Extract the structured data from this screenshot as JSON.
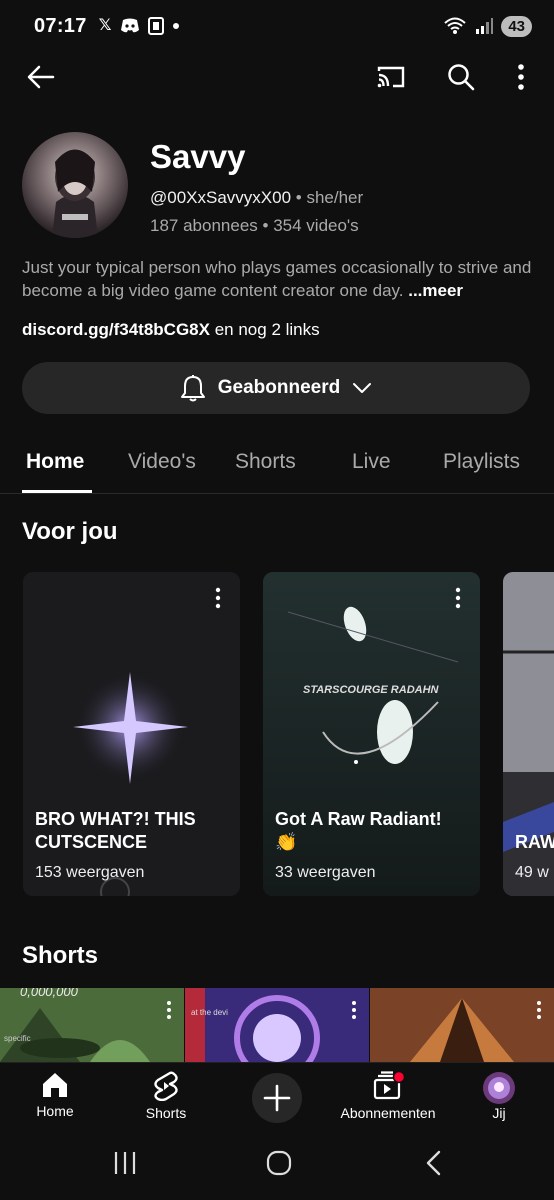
{
  "status_bar": {
    "time": "07:17",
    "notification_icons": [
      "x-logo-icon",
      "discord-icon",
      "app-icon",
      "dot-icon"
    ],
    "battery": "43"
  },
  "app_bar": {
    "icons": [
      "back-arrow-icon",
      "cast-icon",
      "search-icon",
      "more-vert-icon"
    ]
  },
  "channel": {
    "name": "Savvy",
    "handle": "@00XxSavvyxX00",
    "pronouns": "she/her",
    "subscribers": "187 abonnees",
    "videos": "354 video's",
    "separator": "•",
    "description": "Just your typical person who plays games occasionally to strive and become a big video game content creator one day.",
    "more_label": "...meer",
    "link": "discord.gg/f34t8bCG8X",
    "link_rest": "en nog 2 links"
  },
  "subscribe": {
    "label": "Geabonneerd"
  },
  "tabs": [
    {
      "label": "Home",
      "active": true
    },
    {
      "label": "Video's",
      "active": false
    },
    {
      "label": "Shorts",
      "active": false
    },
    {
      "label": "Live",
      "active": false
    },
    {
      "label": "Playlists",
      "active": false
    }
  ],
  "for_you": {
    "title": "Voor jou",
    "cards": [
      {
        "title": "BRO WHAT?! THIS CUTSCENCE",
        "views": "153 weergaven"
      },
      {
        "title": "Got A Raw Radiant! 👏",
        "views": "33 weergaven",
        "overlay": "STARSCOURGE RADAHN"
      },
      {
        "title": "RAW",
        "views": "49 w"
      }
    ]
  },
  "shorts": {
    "title": "Shorts",
    "thumb_text": [
      "0,000,000",
      "at the devi",
      "specific"
    ]
  },
  "bottom_nav": [
    {
      "label": "Home",
      "icon": "home-icon"
    },
    {
      "label": "Shorts",
      "icon": "shorts-icon"
    },
    {
      "label": "",
      "icon": "create-plus-icon"
    },
    {
      "label": "Abonnementen",
      "icon": "subscriptions-icon"
    },
    {
      "label": "Jij",
      "icon": "avatar-icon"
    }
  ],
  "colors": {
    "background": "#0f0f0f",
    "surface": "#272727",
    "secondary_text": "#aaaaaa",
    "badge_red": "#ff0033"
  }
}
